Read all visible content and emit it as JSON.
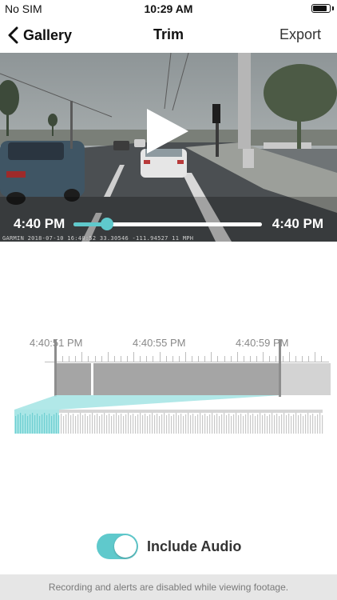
{
  "status_bar": {
    "carrier": "No SIM",
    "time": "10:29 AM",
    "battery_level": 0.85
  },
  "nav": {
    "back_label": "Gallery",
    "title": "Trim",
    "export_label": "Export",
    "back_icon": "chevron-left-icon"
  },
  "video": {
    "start_time": "4:40 PM",
    "end_time": "4:40 PM",
    "playback_progress": 0.18,
    "watermark": "GARMIN  2018-07-10 16:40:52   33.30546  -111.94527   11 MPH",
    "play_icon": "play-icon"
  },
  "timeline": {
    "labels": [
      "4:40:51 PM",
      "4:40:55 PM",
      "4:40:59 PM"
    ]
  },
  "audio": {
    "label": "Include Audio",
    "enabled": true
  },
  "footer": {
    "message": "Recording and alerts are disabled while viewing footage."
  },
  "colors": {
    "accent": "#5fc9cc",
    "selection_gray": "#a5a5a5",
    "footer_bg": "#e6e6e6"
  }
}
